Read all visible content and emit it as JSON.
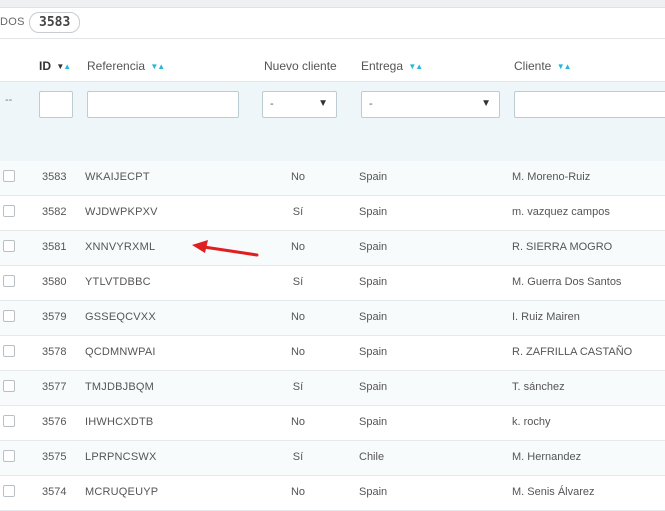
{
  "title": {
    "text": "DOS",
    "count": "3583"
  },
  "columns": {
    "id": "ID",
    "referencia": "Referencia",
    "nuevo_cliente": "Nuevo cliente",
    "entrega": "Entrega",
    "cliente": "Cliente"
  },
  "filters": {
    "dashes": "--",
    "nuevo_cliente_select": "-",
    "entrega_select": "-"
  },
  "icons": {
    "sort": "sort-arrows-icon",
    "caret": "caret-down-icon",
    "checkbox": "checkbox-icon",
    "annotation": "red-arrow-icon"
  },
  "colors": {
    "accent": "#25b9d7",
    "annotation": "#e02020"
  },
  "rows": [
    {
      "id": "3583",
      "ref": "WKAIJECPT",
      "nuevo": "No",
      "entrega": "Spain",
      "cliente": "M. Moreno-Ruiz"
    },
    {
      "id": "3582",
      "ref": "WJDWPKPXV",
      "nuevo": "Sí",
      "entrega": "Spain",
      "cliente": "m. vazquez campos"
    },
    {
      "id": "3581",
      "ref": "XNNVYRXML",
      "nuevo": "No",
      "entrega": "Spain",
      "cliente": "R. SIERRA MOGRO"
    },
    {
      "id": "3580",
      "ref": "YTLVTDBBC",
      "nuevo": "Sí",
      "entrega": "Spain",
      "cliente": "M. Guerra Dos Santos"
    },
    {
      "id": "3579",
      "ref": "GSSEQCVXX",
      "nuevo": "No",
      "entrega": "Spain",
      "cliente": "I. Ruiz Mairen"
    },
    {
      "id": "3578",
      "ref": "QCDMNWPAI",
      "nuevo": "No",
      "entrega": "Spain",
      "cliente": "R. ZAFRILLA CASTAÑO"
    },
    {
      "id": "3577",
      "ref": "TMJDBJBQM",
      "nuevo": "Sí",
      "entrega": "Spain",
      "cliente": "T. sánchez"
    },
    {
      "id": "3576",
      "ref": "IHWHCXDTB",
      "nuevo": "No",
      "entrega": "Spain",
      "cliente": "k. rochy"
    },
    {
      "id": "3575",
      "ref": "LPRPNCSWX",
      "nuevo": "Sí",
      "entrega": "Chile",
      "cliente": "M. Hernandez"
    },
    {
      "id": "3574",
      "ref": "MCRUQEUYP",
      "nuevo": "No",
      "entrega": "Spain",
      "cliente": "M. Senis Álvarez"
    }
  ]
}
